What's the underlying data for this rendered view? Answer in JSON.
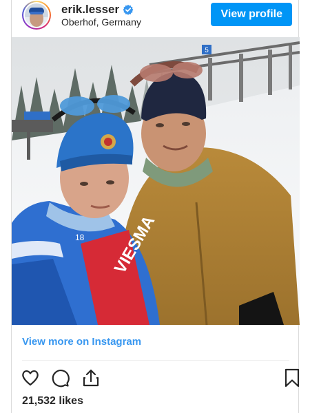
{
  "post": {
    "username": "erik.lesser",
    "location": "Oberhof, Germany",
    "view_profile_label": "View profile",
    "view_more_label": "View more on Instagram",
    "likes": "21,532 likes"
  },
  "colors": {
    "accent": "#0095f6",
    "link": "#3897f0",
    "verified": "#3897f0"
  },
  "icons": {
    "verified": "verified-badge-icon",
    "like": "heart-icon",
    "comment": "comment-icon",
    "share": "share-icon",
    "save": "bookmark-icon"
  },
  "photo": {
    "jacket_text": "VIESMA",
    "number": "18",
    "sign": "5"
  }
}
